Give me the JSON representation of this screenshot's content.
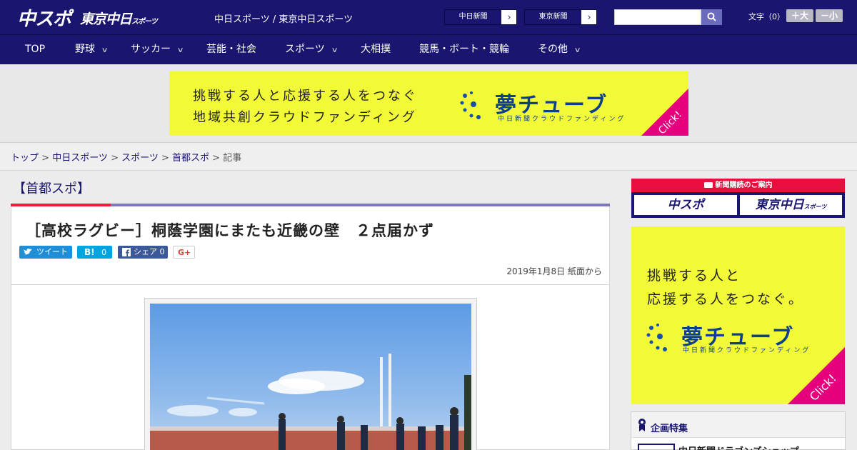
{
  "header": {
    "logo_main": "中スポ",
    "logo_tokyo": "東京中日",
    "logo_tokyo_small": "スポーツ",
    "site_links": "中日スポーツ / 東京中日スポーツ",
    "paper_buttons": [
      {
        "label": "中日新聞",
        "arrow": "›"
      },
      {
        "label": "東京新聞",
        "arrow": "›"
      }
    ],
    "search": {
      "value": "",
      "placeholder": ""
    },
    "font_size_label": "文字（0）",
    "font_larger": "＋大",
    "font_smaller": "－小"
  },
  "nav": {
    "items": [
      {
        "label": "TOP",
        "has_menu": false
      },
      {
        "label": "野球",
        "has_menu": true
      },
      {
        "label": "サッカー",
        "has_menu": true
      },
      {
        "label": "芸能・社会",
        "has_menu": false
      },
      {
        "label": "スポーツ",
        "has_menu": true
      },
      {
        "label": "大相撲",
        "has_menu": false
      },
      {
        "label": "競馬・ボート・競輪",
        "has_menu": false
      },
      {
        "label": "その他",
        "has_menu": true
      }
    ],
    "chevron": "∨"
  },
  "banner": {
    "line1": "挑戦する人と応援する人をつなぐ",
    "line2": "地域共創クラウドファンディング",
    "brand": "夢チューブ",
    "brand_sub": "中日新聞クラウドファンディング",
    "click": "Click!"
  },
  "breadcrumb": {
    "items": [
      "トップ",
      "中日スポーツ",
      "スポーツ",
      "首都スポ"
    ],
    "current": "記事",
    "separator": " > "
  },
  "article": {
    "section": "【首都スポ】",
    "headline": "［高校ラグビー］桐蔭学園にまたも近畿の壁　２点届かず",
    "share": {
      "tweet": "ツイート",
      "hatena": "0",
      "facebook": "シェア 0",
      "gplus": "G+"
    },
    "dateline": "2019年1月8日 紙面から"
  },
  "sidebar": {
    "subscribe_head": "新聞購読のご案内",
    "subscribe_buttons": [
      "中スポ",
      "東京中日"
    ],
    "subscribe_small": "スポーツ",
    "ad": {
      "line1": "挑戦する人と",
      "line2": "応援する人をつなぐ。",
      "brand": "夢チューブ",
      "brand_sub": "中日新聞クラウドファンディング",
      "click": "Click!"
    },
    "feature_title": "企画特集",
    "feature_item": "中日新聞ドラゴンズショップ"
  },
  "colors": {
    "brand_navy": "#1a1670",
    "accent_red": "#e60f3d",
    "ad_yellow": "#f2fa37",
    "ad_pink": "#e6007e"
  }
}
